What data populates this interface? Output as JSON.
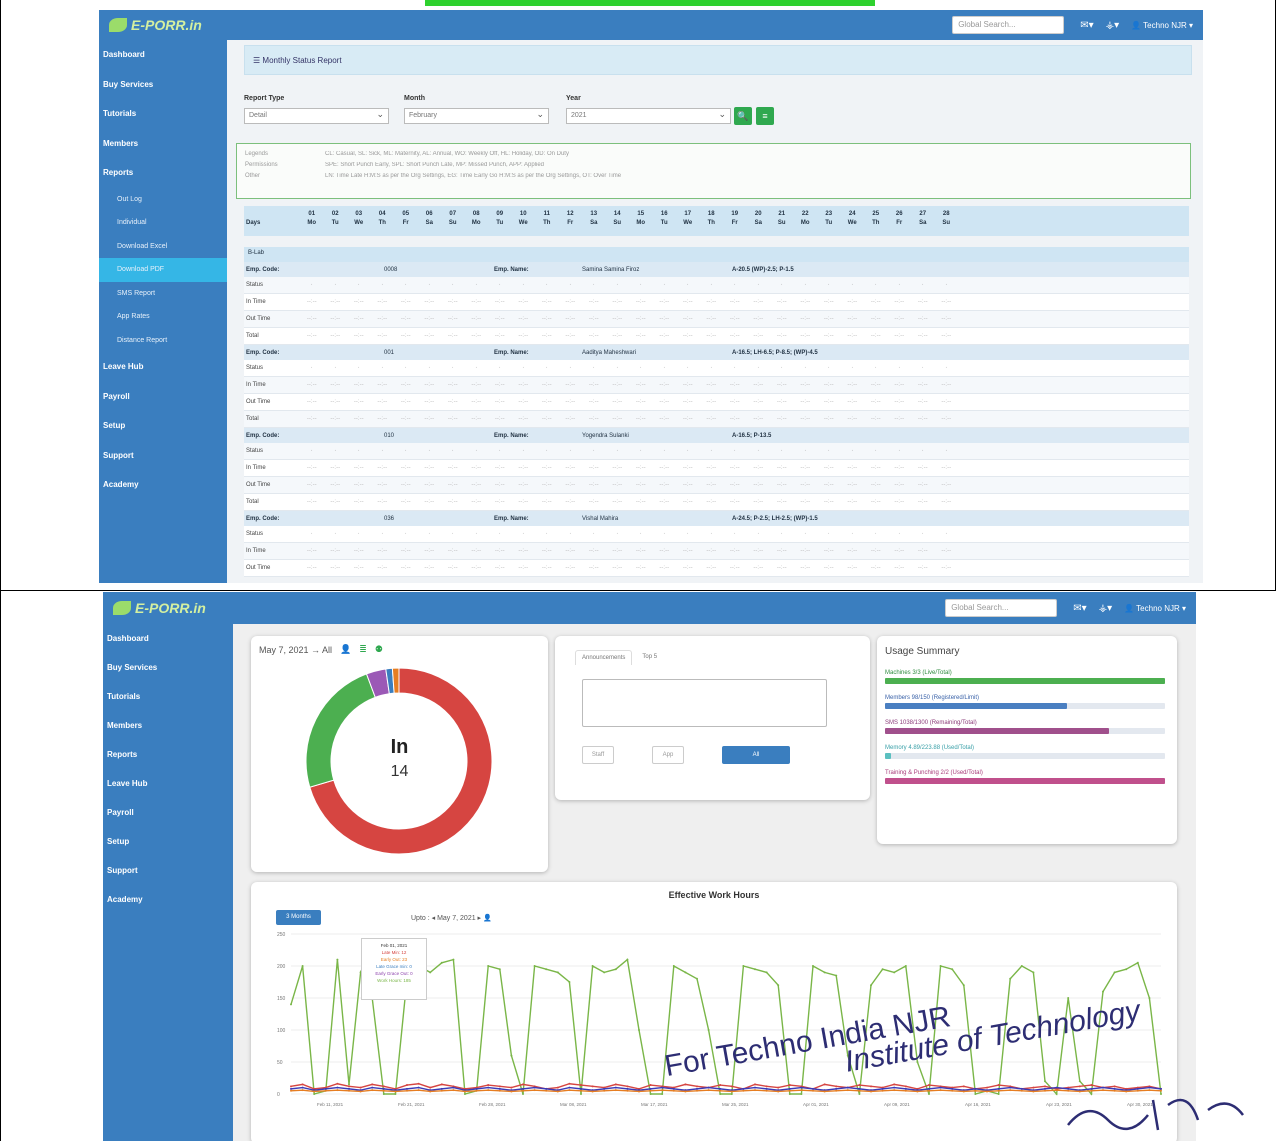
{
  "app": {
    "logo_text": "E-PORR.in",
    "global_search_placeholder": "Global Search...",
    "user_label": "Techno NJR",
    "menu_icon": "envelope-icon",
    "org_icon": "sitemap-icon"
  },
  "sidebar": {
    "items": [
      {
        "label": "Dashboard",
        "icon": "dashboard-icon"
      },
      {
        "label": "Buy Services",
        "icon": "rupee-icon"
      },
      {
        "label": "Tutorials",
        "icon": "info-icon"
      },
      {
        "label": "Members",
        "icon": "users-icon"
      },
      {
        "label": "Reports",
        "icon": "print-icon"
      },
      {
        "label": "Leave Hub",
        "icon": "list-icon"
      },
      {
        "label": "Payroll",
        "icon": "money-icon"
      },
      {
        "label": "Setup",
        "icon": "gears-icon"
      },
      {
        "label": "Support",
        "icon": "book-icon"
      },
      {
        "label": "Academy",
        "icon": "graduation-icon"
      }
    ],
    "reports_sub": [
      "Out Log",
      "Individual",
      "Download Excel",
      "Download PDF",
      "SMS Report",
      "App Rates",
      "Distance Report"
    ],
    "active_sub": 3
  },
  "monthly_report": {
    "page_title": "Monthly Status Report",
    "report_type_label": "Report Type",
    "report_type_value": "Detail",
    "month_label": "Month",
    "month_value": "February",
    "year_label": "Year",
    "year_value": "2021",
    "legend": [
      {
        "k": "Legends",
        "v": "CL: Casual, SL: Sick, ML: Maternity, AL: Annual, WO: Weekly Off, HL: Holiday, OD: On Duty"
      },
      {
        "k": "Permissions",
        "v": "SPE: Short Punch Early, SPL: Short Punch Late, MP: Missed Punch, APP: Applied"
      },
      {
        "k": "Other",
        "v": "LN: Time Late H:M:S as per the Org Settings, EG: Time Early Go H:M:S as per the Org Settings, OT: Over Time"
      }
    ],
    "days_label": "Days",
    "days": [
      [
        "01",
        "Mo"
      ],
      [
        "02",
        "Tu"
      ],
      [
        "03",
        "We"
      ],
      [
        "04",
        "Th"
      ],
      [
        "05",
        "Fr"
      ],
      [
        "06",
        "Sa"
      ],
      [
        "07",
        "Su"
      ],
      [
        "08",
        "Mo"
      ],
      [
        "09",
        "Tu"
      ],
      [
        "10",
        "We"
      ],
      [
        "11",
        "Th"
      ],
      [
        "12",
        "Fr"
      ],
      [
        "13",
        "Sa"
      ],
      [
        "14",
        "Su"
      ],
      [
        "15",
        "Mo"
      ],
      [
        "16",
        "Tu"
      ],
      [
        "17",
        "We"
      ],
      [
        "18",
        "Th"
      ],
      [
        "19",
        "Fr"
      ],
      [
        "20",
        "Sa"
      ],
      [
        "21",
        "Su"
      ],
      [
        "22",
        "Mo"
      ],
      [
        "23",
        "Tu"
      ],
      [
        "24",
        "We"
      ],
      [
        "25",
        "Th"
      ],
      [
        "26",
        "Fr"
      ],
      [
        "27",
        "Sa"
      ],
      [
        "28",
        "Su"
      ]
    ],
    "dept": "B-Lab",
    "emp_code_label": "Emp. Code:",
    "emp_name_label": "Emp. Name:",
    "row_labels": [
      "Status",
      "In Time",
      "Out Time",
      "Total"
    ],
    "employees": [
      {
        "code": "0008",
        "name": "Samina Samina Firoz",
        "summary": "A-20.5 (WP)-2.5; P-1.5"
      },
      {
        "code": "001",
        "name": "Aaditya Maheshwari",
        "summary": "A-16.5; LH-6.5; P-8.5; (WP)-4.5"
      },
      {
        "code": "010",
        "name": "Yogendra Sulanki",
        "summary": "A-16.5; P-13.5"
      },
      {
        "code": "036",
        "name": "Vishal Mahira",
        "summary": "A-24.5; P-2.5; LH-2.5; (WP)-1.5"
      }
    ]
  },
  "dashboard": {
    "donut": {
      "date_label": "May 7, 2021 → All",
      "center_label": "In",
      "center_value": "14",
      "segments": [
        {
          "value": 62,
          "color": "#d64541"
        },
        {
          "value": 21,
          "color": "#4caf50"
        },
        {
          "value": 3,
          "color": "#9b59b6"
        },
        {
          "value": 1,
          "color": "#3a7ebf"
        },
        {
          "value": 1,
          "color": "#e67e22"
        }
      ]
    },
    "announce": {
      "tabs": [
        "Announcements",
        "Top 5"
      ],
      "buttons": [
        "Staff",
        "App",
        "All"
      ]
    },
    "usage": {
      "title": "Usage Summary",
      "items": [
        {
          "label": "Machines 3/3 (Live/Total)",
          "pct": 1.0,
          "color": "#4caf50",
          "label_color": "#2e8b3e"
        },
        {
          "label": "Members 98/150 (Registered/Limit)",
          "pct": 0.65,
          "color": "#4a7fc1",
          "label_color": "#3a62a8"
        },
        {
          "label": "SMS 1038/1300 (Remaining/Total)",
          "pct": 0.8,
          "color": "#a0508c",
          "label_color": "#8c3c7a"
        },
        {
          "label": "Memory 4.89/223.88 (Used/Total)",
          "pct": 0.02,
          "color": "#5bc0c0",
          "label_color": "#3aa0a8"
        },
        {
          "label": "Training & Punching 2/2 (Used/Total)",
          "pct": 1.0,
          "color": "#c0508c",
          "label_color": "#a83c7a"
        }
      ]
    },
    "work_hours": {
      "title": "Effective Work Hours",
      "range_button": "3 Months",
      "upto_label": "Upto : ◂ May 7, 2021 ▸",
      "tooltip": [
        "Feb 01, 2021",
        "Late Min: 12",
        "Early Out: 23",
        "Late Grace min: 0",
        "Early Grace Out: 0",
        "Work Hours: 185"
      ]
    }
  },
  "watermark": {
    "line1": "For Techno India NJR",
    "line2": "Institute of Technology"
  },
  "chart_data": {
    "type": "line",
    "title": "Effective Work Hours",
    "ylim": [
      0,
      250
    ],
    "yticks": [
      0,
      50,
      100,
      150,
      200,
      250
    ],
    "xticks": [
      "Feb 11, 2021",
      "Feb 21, 2021",
      "Feb 28, 2021",
      "Mar 08, 2021",
      "Mar 17, 2021",
      "Mar 25, 2021",
      "Apr 01, 2021",
      "Apr 09, 2021",
      "Apr 16, 2021",
      "Apr 23, 2021",
      "Apr 30, 2021"
    ],
    "series": [
      {
        "color": "#7ab648",
        "values": [
          140,
          200,
          0,
          5,
          210,
          15,
          190,
          150,
          0,
          0,
          180,
          200,
          190,
          205,
          210,
          0,
          5,
          200,
          195,
          60,
          0,
          200,
          195,
          190,
          175,
          0,
          200,
          190,
          195,
          210,
          100,
          0,
          0,
          200,
          190,
          180,
          100,
          0,
          0,
          200,
          195,
          190,
          170,
          0,
          0,
          200,
          190,
          185,
          60,
          0,
          170,
          195,
          190,
          200,
          50,
          0,
          200,
          195,
          170,
          0,
          5,
          0,
          180,
          200,
          190,
          20,
          0,
          150,
          20,
          0,
          160,
          190,
          195,
          205,
          150,
          0
        ]
      },
      {
        "color": "#d64541",
        "values": [
          12,
          15,
          8,
          10,
          16,
          12,
          10,
          15,
          12,
          8,
          14,
          16,
          10,
          15,
          12,
          8,
          10,
          14,
          12,
          10,
          15,
          12,
          8,
          10,
          16,
          14,
          12,
          10,
          15,
          12,
          8,
          14,
          12,
          10,
          15,
          12,
          10,
          14,
          12,
          8,
          15,
          12,
          10,
          14,
          12,
          8,
          15,
          12,
          10,
          14,
          12,
          10,
          15,
          12,
          8,
          14,
          12,
          10,
          12,
          8,
          10,
          14,
          12,
          8,
          10,
          12,
          8,
          10,
          12,
          14,
          10,
          12,
          8,
          10,
          12,
          8
        ]
      },
      {
        "color": "#3a3ab8",
        "values": [
          8,
          10,
          6,
          8,
          10,
          8,
          6,
          10,
          8,
          6,
          8,
          10,
          6,
          8,
          10,
          6,
          8,
          10,
          8,
          6,
          8,
          10,
          8,
          6,
          10,
          8,
          6,
          8,
          10,
          8,
          6,
          8,
          10,
          8,
          6,
          8,
          10,
          8,
          6,
          8,
          10,
          8,
          6,
          8,
          10,
          8,
          6,
          8,
          10,
          8,
          6,
          8,
          10,
          8,
          6,
          8,
          10,
          8,
          6,
          8,
          6,
          8,
          10,
          8,
          6,
          8,
          10,
          8,
          6,
          8,
          10,
          8,
          6,
          8,
          10,
          8
        ]
      },
      {
        "color": "#e67e22",
        "values": [
          5,
          6,
          4,
          5,
          6,
          5,
          4,
          6,
          5,
          4,
          5,
          6,
          4,
          5,
          6,
          4,
          5,
          6,
          5,
          4,
          5,
          6,
          5,
          4,
          6,
          5,
          4,
          5,
          6,
          5,
          4,
          5,
          6,
          5,
          4,
          5,
          6,
          5,
          4,
          5,
          6,
          5,
          4,
          5,
          6,
          5,
          4,
          5,
          6,
          5,
          4,
          5,
          6,
          5,
          4,
          5,
          6,
          5,
          4,
          5,
          4,
          5,
          6,
          5,
          4,
          5,
          6,
          5,
          4,
          5,
          6,
          5,
          4,
          5,
          6,
          5
        ]
      }
    ]
  }
}
